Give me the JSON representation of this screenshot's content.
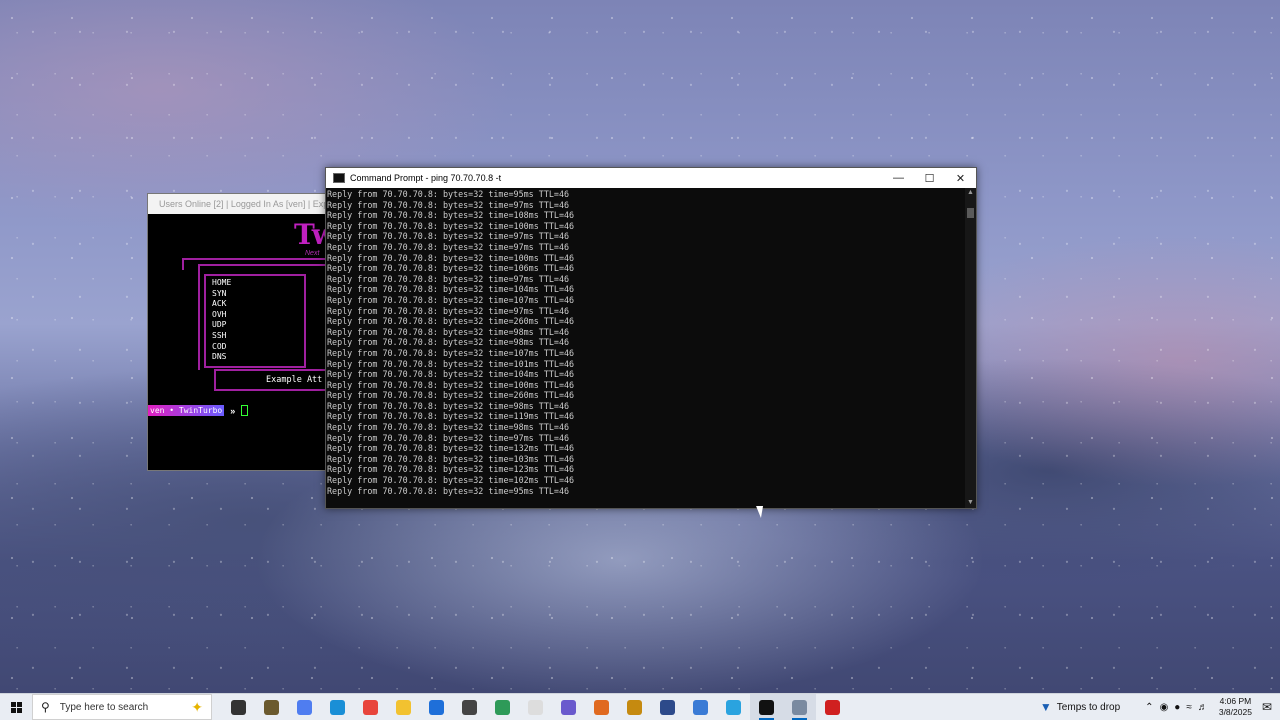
{
  "back_window": {
    "title": "Users Online [2] | Logged In As [ven] | Expires",
    "logo": "Tw",
    "logo_sub": "Next",
    "menu_items": [
      "HOME",
      "SYN",
      "ACK",
      "OVH",
      "UDP",
      "SSH",
      "COD",
      "DNS"
    ],
    "example_text": "Example Att",
    "prompt_badge": "ven • TwinTurbo",
    "prompt_arrow": "»"
  },
  "cmd_window": {
    "title": "Command Prompt - ping  70.70.70.8 -t",
    "minimize": "—",
    "maximize": "☐",
    "close": "✕",
    "lines": [
      "Reply from 70.70.70.8: bytes=32 time=95ms TTL=46",
      "Reply from 70.70.70.8: bytes=32 time=97ms TTL=46",
      "Reply from 70.70.70.8: bytes=32 time=108ms TTL=46",
      "Reply from 70.70.70.8: bytes=32 time=100ms TTL=46",
      "Reply from 70.70.70.8: bytes=32 time=97ms TTL=46",
      "Reply from 70.70.70.8: bytes=32 time=97ms TTL=46",
      "Reply from 70.70.70.8: bytes=32 time=100ms TTL=46",
      "Reply from 70.70.70.8: bytes=32 time=106ms TTL=46",
      "Reply from 70.70.70.8: bytes=32 time=97ms TTL=46",
      "Reply from 70.70.70.8: bytes=32 time=104ms TTL=46",
      "Reply from 70.70.70.8: bytes=32 time=107ms TTL=46",
      "Reply from 70.70.70.8: bytes=32 time=97ms TTL=46",
      "Reply from 70.70.70.8: bytes=32 time=260ms TTL=46",
      "Reply from 70.70.70.8: bytes=32 time=98ms TTL=46",
      "Reply from 70.70.70.8: bytes=32 time=98ms TTL=46",
      "Reply from 70.70.70.8: bytes=32 time=107ms TTL=46",
      "Reply from 70.70.70.8: bytes=32 time=101ms TTL=46",
      "Reply from 70.70.70.8: bytes=32 time=104ms TTL=46",
      "Reply from 70.70.70.8: bytes=32 time=100ms TTL=46",
      "Reply from 70.70.70.8: bytes=32 time=260ms TTL=46",
      "Reply from 70.70.70.8: bytes=32 time=98ms TTL=46",
      "Reply from 70.70.70.8: bytes=32 time=119ms TTL=46",
      "Reply from 70.70.70.8: bytes=32 time=98ms TTL=46",
      "Reply from 70.70.70.8: bytes=32 time=97ms TTL=46",
      "Reply from 70.70.70.8: bytes=32 time=132ms TTL=46",
      "Reply from 70.70.70.8: bytes=32 time=103ms TTL=46",
      "Reply from 70.70.70.8: bytes=32 time=123ms TTL=46",
      "Reply from 70.70.70.8: bytes=32 time=102ms TTL=46",
      "Reply from 70.70.70.8: bytes=32 time=95ms TTL=46"
    ]
  },
  "taskbar": {
    "search_placeholder": "Type here to search",
    "icons": [
      {
        "name": "task-view-icon",
        "color": "#333333"
      },
      {
        "name": "app-icon-1",
        "color": "#6b5a2e"
      },
      {
        "name": "app-icon-2",
        "color": "#4f7df0"
      },
      {
        "name": "edge-icon",
        "color": "#1a8fd6"
      },
      {
        "name": "chrome-icon",
        "color": "#e8453c"
      },
      {
        "name": "file-explorer-icon",
        "color": "#f2c230"
      },
      {
        "name": "store-icon",
        "color": "#1e6fd9"
      },
      {
        "name": "app-icon-3",
        "color": "#444444"
      },
      {
        "name": "app-icon-4",
        "color": "#2e9a58"
      },
      {
        "name": "file-icon",
        "color": "#dddddd"
      },
      {
        "name": "app-icon-5",
        "color": "#6a5acd"
      },
      {
        "name": "app-icon-6",
        "color": "#e06a20"
      },
      {
        "name": "app-icon-7",
        "color": "#c58a10"
      },
      {
        "name": "app-icon-8",
        "color": "#2d4a8a"
      },
      {
        "name": "app-icon-9",
        "color": "#3a7bd5"
      },
      {
        "name": "telegram-icon",
        "color": "#2aa3df"
      },
      {
        "name": "terminal-icon",
        "color": "#111111",
        "active": true
      },
      {
        "name": "app-icon-10",
        "color": "#7a8aa0",
        "active": true
      },
      {
        "name": "app-icon-11",
        "color": "#d02020"
      }
    ],
    "weather": "Temps to drop",
    "time": "4:06 PM",
    "date": "3/8/2025"
  }
}
